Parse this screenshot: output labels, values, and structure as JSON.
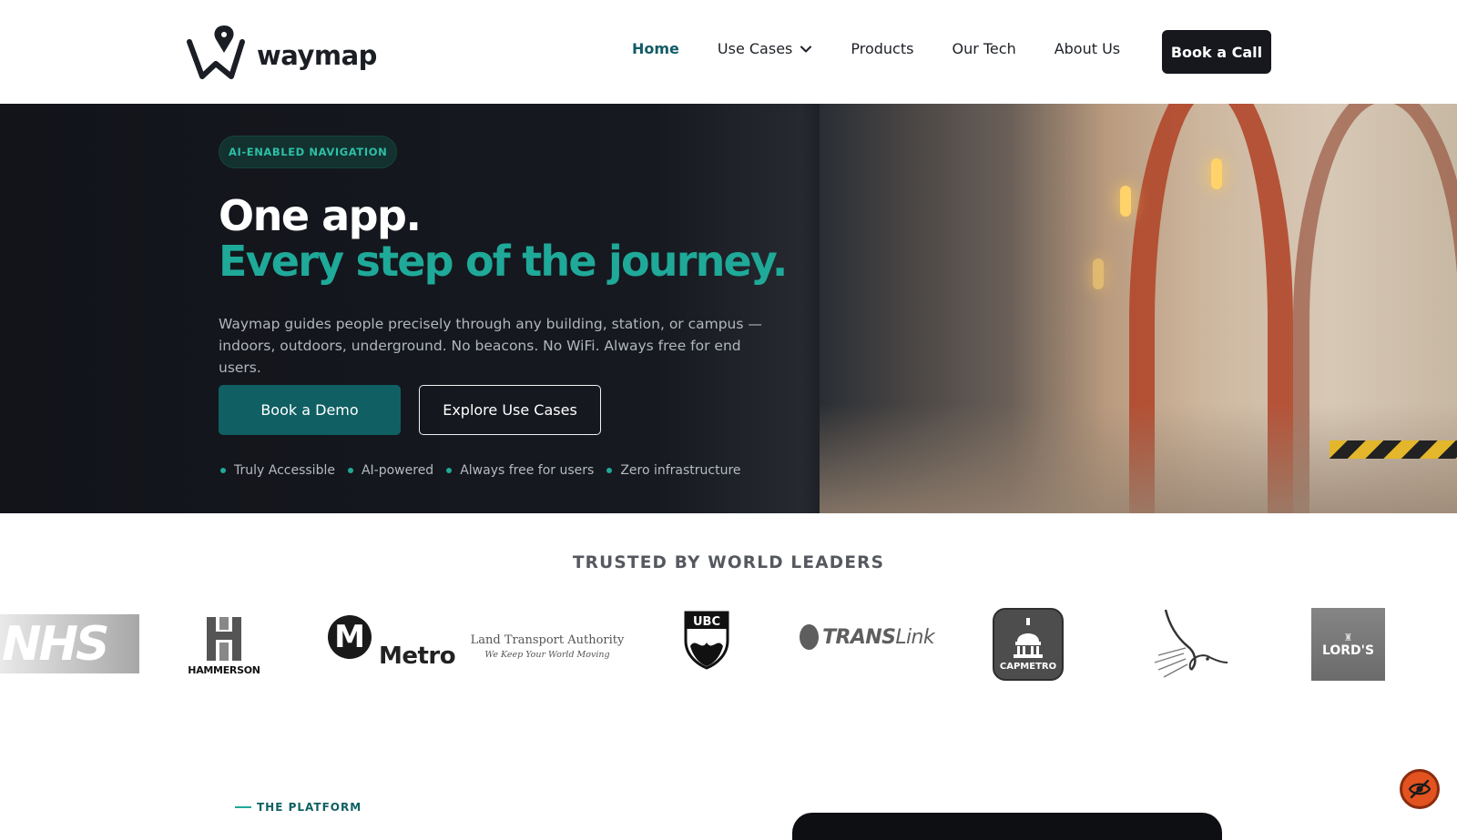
{
  "brand": {
    "name": "waymap"
  },
  "nav": {
    "items": [
      {
        "label": "Home",
        "active": true
      },
      {
        "label": "Use Cases",
        "has_dropdown": true
      },
      {
        "label": "Products"
      },
      {
        "label": "Our Tech"
      },
      {
        "label": "About Us"
      }
    ],
    "cta": "Book a Call"
  },
  "hero": {
    "badge": "AI-ENABLED NAVIGATION",
    "headline_line1": "One app.",
    "headline_line2": "Every step of the journey.",
    "description": "Waymap guides people precisely through any building, station, or campus — indoors, outdoors, underground. No beacons. No WiFi. Always free for end users.",
    "primary_button": "Book a Demo",
    "secondary_button": "Explore Use Cases",
    "features": [
      "Truly Accessible",
      "AI-powered",
      "Always free for users",
      "Zero infrastructure"
    ]
  },
  "trusted": {
    "title": "TRUSTED BY WORLD LEADERS",
    "logos": [
      {
        "name": "NHS",
        "text": "NHS"
      },
      {
        "name": "Hammerson",
        "text": "HAMMERSON"
      },
      {
        "name": "Metro",
        "mark": "M",
        "text": "Metro"
      },
      {
        "name": "Land Transport Authority",
        "text": "Land Transport Authority",
        "tagline": "We Keep Your World Moving"
      },
      {
        "name": "UBC",
        "text": "UBC"
      },
      {
        "name": "TransLink",
        "text_bold": "TRANS",
        "text_light": "Link"
      },
      {
        "name": "CapMetro",
        "text": "CAPMETRO"
      },
      {
        "name": "Bird logo"
      },
      {
        "name": "Lord's",
        "text": "LORD'S"
      }
    ]
  },
  "platform": {
    "eyebrow": "THE PLATFORM"
  },
  "colors": {
    "accent": "#1fa999",
    "brand_dark": "#0f5f63",
    "hero_bg": "#12141a",
    "accessibility": "#e2531f"
  }
}
